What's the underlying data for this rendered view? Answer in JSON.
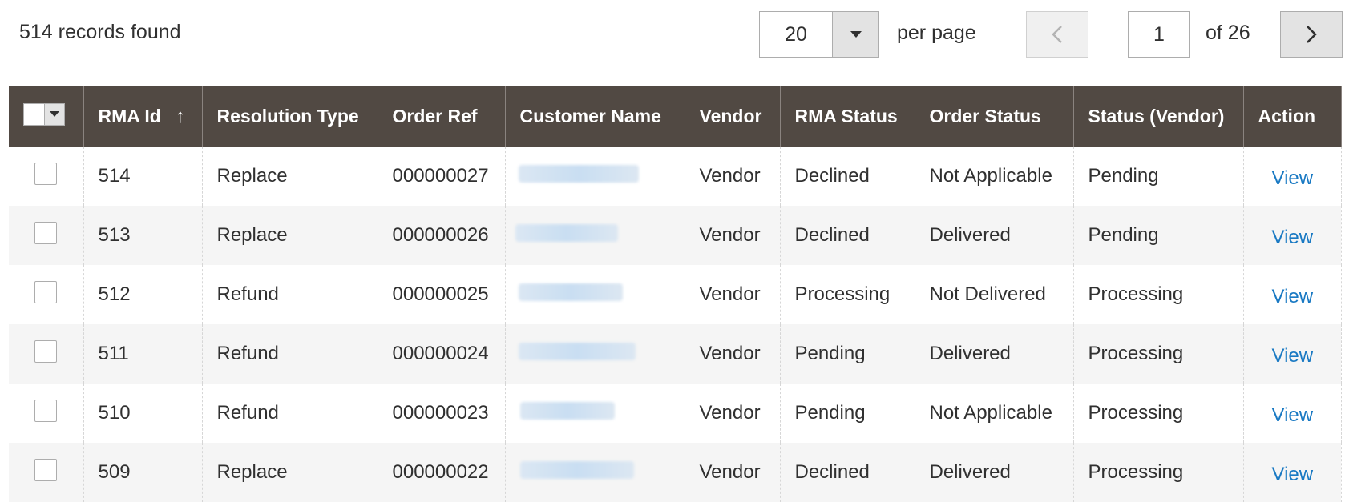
{
  "toolbar": {
    "records_found": "514 records found",
    "per_page_value": "20",
    "per_page_label": "per page",
    "current_page": "1",
    "page_of": "of 26"
  },
  "grid": {
    "headers": {
      "rma_id": "RMA Id",
      "sort_indicator": "↑",
      "resolution_type": "Resolution Type",
      "order_ref": "Order Ref",
      "customer_name": "Customer Name",
      "vendor": "Vendor",
      "rma_status": "RMA Status",
      "order_status": "Order Status",
      "status_vendor": "Status (Vendor)",
      "action": "Action"
    },
    "rows": [
      {
        "rma_id": "514",
        "resolution_type": "Replace",
        "order_ref": "000000027",
        "vendor": "Vendor",
        "rma_status": "Declined",
        "order_status": "Not Applicable",
        "status_vendor": "Pending",
        "action": "View"
      },
      {
        "rma_id": "513",
        "resolution_type": "Replace",
        "order_ref": "000000026",
        "vendor": "Vendor",
        "rma_status": "Declined",
        "order_status": "Delivered",
        "status_vendor": "Pending",
        "action": "View"
      },
      {
        "rma_id": "512",
        "resolution_type": "Refund",
        "order_ref": "000000025",
        "vendor": "Vendor",
        "rma_status": "Processing",
        "order_status": "Not Delivered",
        "status_vendor": "Processing",
        "action": "View"
      },
      {
        "rma_id": "511",
        "resolution_type": "Refund",
        "order_ref": "000000024",
        "vendor": "Vendor",
        "rma_status": "Pending",
        "order_status": "Delivered",
        "status_vendor": "Processing",
        "action": "View"
      },
      {
        "rma_id": "510",
        "resolution_type": "Refund",
        "order_ref": "000000023",
        "vendor": "Vendor",
        "rma_status": "Pending",
        "order_status": "Not Applicable",
        "status_vendor": "Processing",
        "action": "View"
      },
      {
        "rma_id": "509",
        "resolution_type": "Replace",
        "order_ref": "000000022",
        "vendor": "Vendor",
        "rma_status": "Declined",
        "order_status": "Delivered",
        "status_vendor": "Processing",
        "action": "View"
      }
    ]
  },
  "icons": {
    "dropdown": "chevron-down-icon",
    "prev": "chevron-left-icon",
    "next": "chevron-right-icon"
  },
  "colors": {
    "header_bg": "#514943",
    "link": "#1979c3",
    "alt_row": "#f5f5f5"
  }
}
